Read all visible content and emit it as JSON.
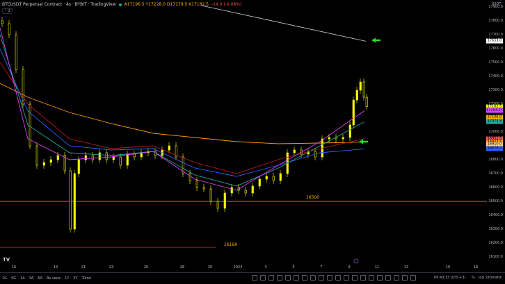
{
  "header": {
    "symbol": "BTCUSDT Perpetual Contract · 4s · BYBIT · TradingView",
    "ohlc": "A17196.5 Y17228.0 D17179.5 K17182.5",
    "change": "-14.0 (-0.08%)",
    "collapse_label": "⌃ 2",
    "currency": "USDT·"
  },
  "colors": {
    "bg": "#000000",
    "candle": "#ffff00",
    "accent": "#ffb000",
    "arrow": "#22dd22"
  },
  "price_axis": {
    "ticks": [
      "17900.0",
      "17800.0",
      "17700.0",
      "17600.0",
      "17500.0",
      "17400.0",
      "17300.0",
      "17200.0",
      "17100.0",
      "17000.0",
      "16900.0",
      "16800.0",
      "16700.0",
      "16600.0",
      "16500.0",
      "16400.0",
      "16300.0",
      "16200.0",
      "16100.0"
    ],
    "labels": [
      {
        "text": "17653.0",
        "price": 17653,
        "color": "#ffffff"
      },
      {
        "text": "17182.5",
        "price": 17182.5,
        "color": "#ffff00"
      },
      {
        "text": "17153.27",
        "price": 17153,
        "color": "#e040fb"
      },
      {
        "text": "17106.0",
        "price": 17106,
        "color": "#ffb000"
      },
      {
        "text": "17073.5",
        "price": 17073,
        "color": "#26a69a"
      },
      {
        "text": "16952.5",
        "price": 16952,
        "color": "#ef5350"
      },
      {
        "text": "16927.5",
        "price": 16927,
        "color": "#ff9800"
      },
      {
        "text": "16910.0",
        "price": 16910,
        "color": "#ffcc80"
      },
      {
        "text": "16878.0",
        "price": 16878,
        "color": "#2962ff"
      }
    ]
  },
  "time_axis": {
    "ticks": [
      "16",
      "19",
      "21",
      "23",
      "26",
      "28",
      "30",
      "2023",
      "3",
      "5",
      "7",
      "9",
      "11",
      "13",
      "16",
      "18"
    ]
  },
  "levels": [
    {
      "text": "16500",
      "price": 16500
    },
    {
      "text": "16169",
      "price": 16169
    }
  ],
  "logo": "TV",
  "timeframes": [
    "1G",
    "5G",
    "1A",
    "3A",
    "6A",
    "Bu sene",
    "1Y",
    "5Y",
    "Tümü"
  ],
  "clock": "09:43:33 (UTC+3)",
  "options": [
    "%",
    "log",
    "otomatik"
  ]
}
